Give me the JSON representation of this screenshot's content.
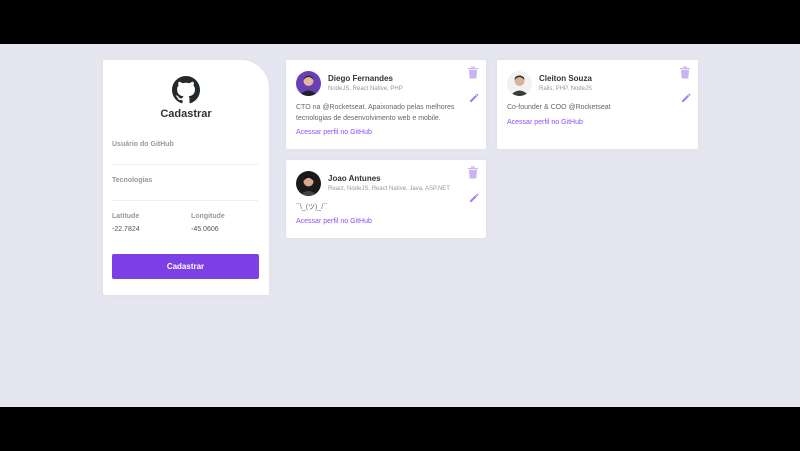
{
  "form": {
    "title": "Cadastrar",
    "github_user_label": "Usuário do GitHub",
    "techs_label": "Tecnologias",
    "latitude_label": "Latitude",
    "latitude_value": "-22.7824",
    "longitude_label": "Longitude",
    "longitude_value": "-45.0606",
    "submit_label": "Cadastrar"
  },
  "devs": [
    {
      "name": "Diego Fernandes",
      "techs": "NodeJS, React Native, PHP",
      "bio_line1": "CTO na @Rocketseat. Apaixonado pelas melhores",
      "bio_line2": "tecnologias de desenvolvimento web e mobile.",
      "link": "Acessar perfil no GitHub"
    },
    {
      "name": "Cleiton Souza",
      "techs": "Rails, PHP, NodeJS",
      "bio_line1": "Co-founder & COO @Rocketseat",
      "bio_line2": "",
      "link": "Acessar perfil no GitHub"
    },
    {
      "name": "Joao Antunes",
      "techs": "React, NodeJS, React Native, Java, ASP.NET",
      "bio_line1": "¯\\_(ツ)_/¯",
      "bio_line2": "",
      "link": "Acessar perfil no GitHub"
    }
  ],
  "colors": {
    "accent": "#7d40e7",
    "link": "#8e4dff",
    "background": "#e6e6f0",
    "icon": "#c9b3f2"
  },
  "icons": [
    "github-logo-icon",
    "trash-icon",
    "pencil-icon"
  ]
}
